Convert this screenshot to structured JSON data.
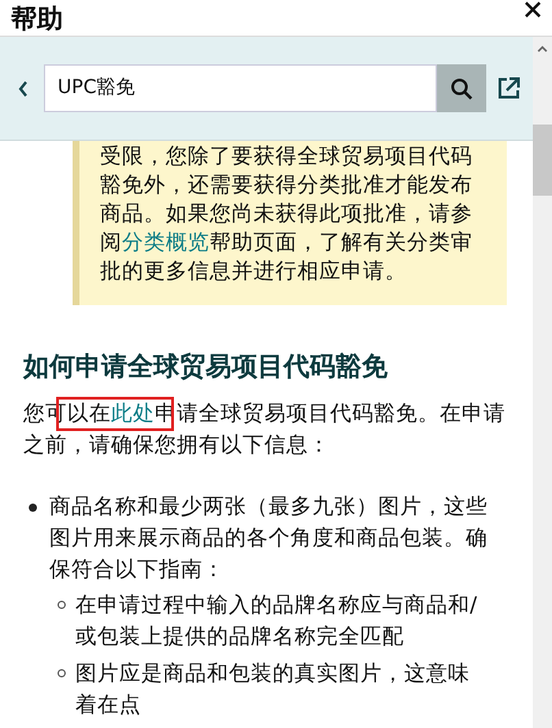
{
  "title": "帮助",
  "search": {
    "value": "UPC豁免"
  },
  "note": {
    "before": "受限，您除了要获得全球贸易项目代码豁免外，还需要获得分类批准才能发布商品。如果您尚未获得此项批准，请参阅",
    "link": "分类概览",
    "after": "帮助页面，了解有关分类审批的更多信息并进行相应申请。"
  },
  "heading": "如何申请全球贸易项目代码豁免",
  "intro": {
    "before": "您可",
    "boxed_before": "以在",
    "link": "此处",
    "boxed_after": "申",
    "after": "请全球贸易项目代码豁免。在申请之前，请确保您拥有以下信息："
  },
  "list": [
    {
      "text": "商品名称和最少两张（最多九张）图片，这些图片用来展示商品的各个角度和商品包装。确保符合以下指南：",
      "children": [
        {
          "text": "在申请过程中输入的品牌名称应与商品和/或包装上提供的品牌名称完全匹配"
        },
        {
          "text": "图片应是商品和包装的真实图片，这意味着在点"
        }
      ]
    }
  ]
}
